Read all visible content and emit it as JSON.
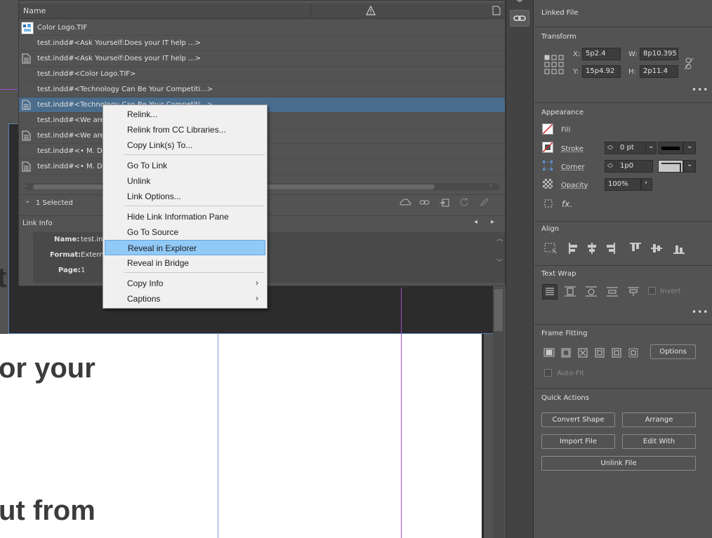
{
  "canvas": {
    "page_text": [
      "t",
      "or your",
      "ut from"
    ]
  },
  "links_panel": {
    "column_name": "Name",
    "rows": [
      {
        "name": "Color Logo.TIF",
        "icon": "image-thumbnail-icon",
        "selected": false
      },
      {
        "name": "test.indd#<Ask Yourself:Does your IT help ...>",
        "icon": "none",
        "selected": false
      },
      {
        "name": "test.indd#<Ask Yourself:Does your IT help ...>",
        "icon": "document-icon",
        "selected": false
      },
      {
        "name": "test.indd#<Color Logo.TIF>",
        "icon": "none",
        "selected": false
      },
      {
        "name": "test.indd#<Technology Can Be Your Competiti...>",
        "icon": "none",
        "selected": false
      },
      {
        "name": "test.indd#<Technology Can Be Your Competiti...>",
        "icon": "document-icon",
        "selected": true
      },
      {
        "name": "test.indd#<We are N",
        "icon": "none",
        "selected": false
      },
      {
        "name": "test.indd#<We are N",
        "icon": "document-icon",
        "selected": false
      },
      {
        "name": "test.indd#<•  M. Dav",
        "icon": "none",
        "selected": false
      },
      {
        "name": "test.indd#<•  M. Dav",
        "icon": "document-icon",
        "selected": false
      }
    ],
    "selection_status": "1 Selected",
    "link_info": {
      "title": "Link Info",
      "name_label": "Name:",
      "name_value": "test.indd",
      "format_label": "Format:",
      "format_value": "Externa",
      "page_label": "Page:",
      "page_value": "1"
    }
  },
  "context_menu": {
    "groups": [
      [
        {
          "label": "Relink...",
          "highlighted": false,
          "submenu": false
        },
        {
          "label": "Relink from CC Libraries...",
          "highlighted": false,
          "submenu": false
        },
        {
          "label": "Copy Link(s) To...",
          "highlighted": false,
          "submenu": false
        }
      ],
      [
        {
          "label": "Go To Link",
          "highlighted": false,
          "submenu": false
        },
        {
          "label": "Unlink",
          "highlighted": false,
          "submenu": false
        },
        {
          "label": "Link Options...",
          "highlighted": false,
          "submenu": false
        }
      ],
      [
        {
          "label": "Hide Link Information Pane",
          "highlighted": false,
          "submenu": false
        },
        {
          "label": "Go To Source",
          "highlighted": false,
          "submenu": false
        },
        {
          "label": "Reveal in Explorer",
          "highlighted": true,
          "submenu": false
        },
        {
          "label": "Reveal in Bridge",
          "highlighted": false,
          "submenu": false
        }
      ],
      [
        {
          "label": "Copy Info",
          "highlighted": false,
          "submenu": true
        },
        {
          "label": "Captions",
          "highlighted": false,
          "submenu": true
        }
      ]
    ],
    "submenu_glyph": "›"
  },
  "properties": {
    "header": "Linked File",
    "transform": {
      "title": "Transform",
      "x_label": "X:",
      "x_value": "5p2.4",
      "y_label": "Y:",
      "y_value": "15p4.92",
      "w_label": "W:",
      "w_value": "8p10.395",
      "h_label": "H:",
      "h_value": "2p11.4",
      "more": "•••"
    },
    "appearance": {
      "title": "Appearance",
      "fill_label": "Fill",
      "stroke_label": "Stroke",
      "stroke_value": "0 pt",
      "corner_label": "Corner",
      "corner_value": "1p0",
      "opacity_label": "Opacity",
      "opacity_value": "100%",
      "fx_label": "fx."
    },
    "align": {
      "title": "Align"
    },
    "text_wrap": {
      "title": "Text Wrap",
      "invert_label": "Invert",
      "more": "•••"
    },
    "frame_fitting": {
      "title": "Frame Fitting",
      "options_label": "Options",
      "autofit_label": "Auto-Fit"
    },
    "quick_actions": {
      "title": "Quick Actions",
      "convert_shape": "Convert Shape",
      "arrange": "Arrange",
      "import_file": "Import File",
      "edit_with": "Edit With",
      "unlink_file": "Unlink File"
    }
  },
  "colors": {
    "menu_highlight": "#91c9f7",
    "selected_row": "#4a6d8d",
    "panel_bg": "#535353",
    "stroke_red": "#d02020"
  }
}
